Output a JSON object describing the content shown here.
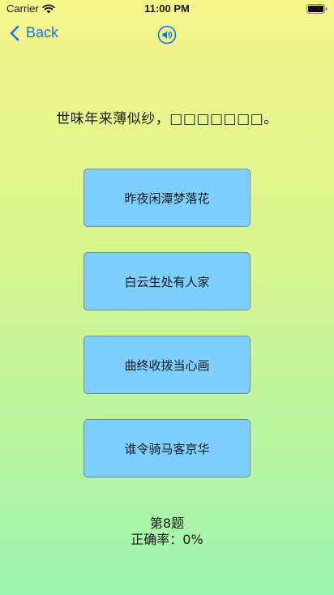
{
  "status_bar": {
    "carrier": "Carrier",
    "time": "11:00 PM"
  },
  "nav": {
    "back_label": "Back",
    "accent_color": "#1976e0"
  },
  "question": {
    "text": "世味年来薄似纱，□□□□□□□。"
  },
  "options": [
    {
      "label": "昨夜闲潭梦落花"
    },
    {
      "label": "白云生处有人家"
    },
    {
      "label": "曲终收拨当心画"
    },
    {
      "label": "谁令骑马客京华"
    }
  ],
  "progress": {
    "question_number": "第8题",
    "accuracy": "正确率：0%"
  },
  "colors": {
    "option_bg": "#7ccfff",
    "gradient_top": "#f6f58a",
    "gradient_bottom": "#9cf5ae"
  }
}
